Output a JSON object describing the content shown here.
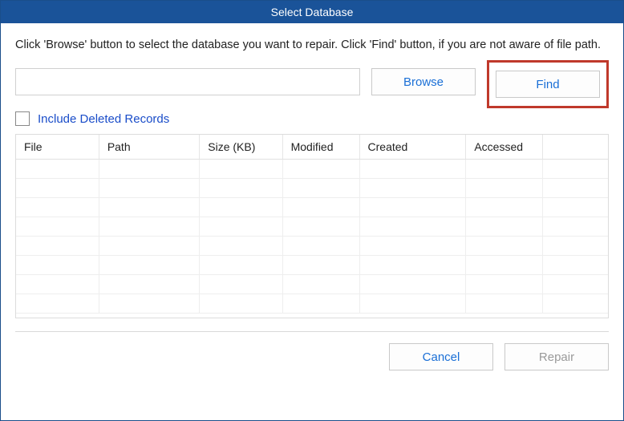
{
  "titlebar": {
    "title": "Select Database"
  },
  "instruction": "Click 'Browse' button to select the database you want to repair. Click 'Find' button, if you are not aware of file path.",
  "path_row": {
    "input_value": "",
    "input_placeholder": "",
    "browse_label": "Browse",
    "find_label": "Find"
  },
  "checkbox": {
    "label": "Include Deleted Records",
    "checked": false
  },
  "table": {
    "headers": [
      "File",
      "Path",
      "Size (KB)",
      "Modified",
      "Created",
      "Accessed",
      ""
    ],
    "rows": []
  },
  "footer": {
    "cancel_label": "Cancel",
    "repair_label": "Repair"
  }
}
